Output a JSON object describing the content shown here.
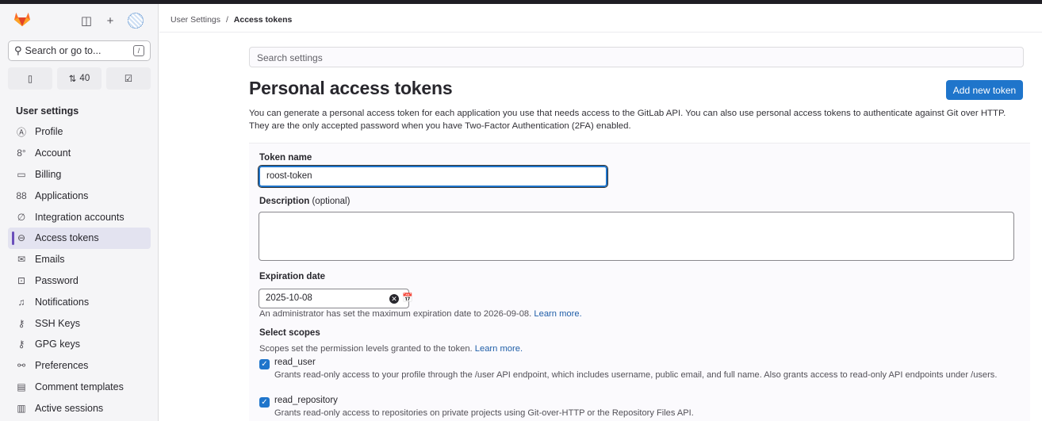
{
  "sidebar": {
    "search_label": "Search or go to...",
    "search_shortcut": "/",
    "counts": [
      {
        "icon": "issues-icon",
        "label": ""
      },
      {
        "icon": "merge-request-icon",
        "label": "40"
      },
      {
        "icon": "todo-icon",
        "label": ""
      }
    ],
    "section_title": "User settings",
    "items": [
      {
        "label": "Profile",
        "icon": "profile-icon",
        "glyph": "Ⓐ"
      },
      {
        "label": "Account",
        "icon": "account-icon",
        "glyph": "8°"
      },
      {
        "label": "Billing",
        "icon": "billing-icon",
        "glyph": "▭"
      },
      {
        "label": "Applications",
        "icon": "applications-icon",
        "glyph": "88"
      },
      {
        "label": "Integration accounts",
        "icon": "integration-icon",
        "glyph": "∅"
      },
      {
        "label": "Access tokens",
        "icon": "token-icon",
        "glyph": "⊖",
        "active": true
      },
      {
        "label": "Emails",
        "icon": "mail-icon",
        "glyph": "✉"
      },
      {
        "label": "Password",
        "icon": "lock-icon",
        "glyph": "⊡"
      },
      {
        "label": "Notifications",
        "icon": "bell-icon",
        "glyph": "♫"
      },
      {
        "label": "SSH Keys",
        "icon": "key-icon",
        "glyph": "⚷"
      },
      {
        "label": "GPG keys",
        "icon": "key-icon",
        "glyph": "⚷"
      },
      {
        "label": "Preferences",
        "icon": "preferences-icon",
        "glyph": "⚯"
      },
      {
        "label": "Comment templates",
        "icon": "comment-icon",
        "glyph": "▤"
      },
      {
        "label": "Active sessions",
        "icon": "sessions-icon",
        "glyph": "▥"
      }
    ]
  },
  "breadcrumb": {
    "parent": "User Settings",
    "separator": "/",
    "current": "Access tokens"
  },
  "search_settings": {
    "placeholder": "Search settings"
  },
  "header": {
    "title": "Personal access tokens",
    "add_button": "Add new token",
    "intro_line1": "You can generate a personal access token for each application you use that needs access to the GitLab API. You can also use personal access tokens to authenticate against Git over HTTP.",
    "intro_line2": "They are the only accepted password when you have Two-Factor Authentication (2FA) enabled."
  },
  "form": {
    "token_name_label": "Token name",
    "token_name_value": "roost-token",
    "description_label": "Description",
    "description_optional": "(optional)",
    "description_value": "",
    "expiration_label": "Expiration date",
    "expiration_value": "2025-10-08",
    "expiration_help": "An administrator has set the maximum expiration date to 2026-09-08.",
    "learn_more": "Learn more.",
    "scopes_label": "Select scopes",
    "scopes_help": "Scopes set the permission levels granted to the token.",
    "scopes": [
      {
        "name": "read_user",
        "checked": true,
        "desc": "Grants read-only access to your profile through the /user API endpoint, which includes username, public email, and full name. Also grants access to read-only API endpoints under /users."
      },
      {
        "name": "read_repository",
        "checked": true,
        "desc": "Grants read-only access to repositories on private projects using Git-over-HTTP or the Repository Files API."
      }
    ]
  },
  "colors": {
    "accent": "#1f75cb",
    "active_marker": "#6b4fbb",
    "sidebar_bg": "#f5f5f7"
  }
}
